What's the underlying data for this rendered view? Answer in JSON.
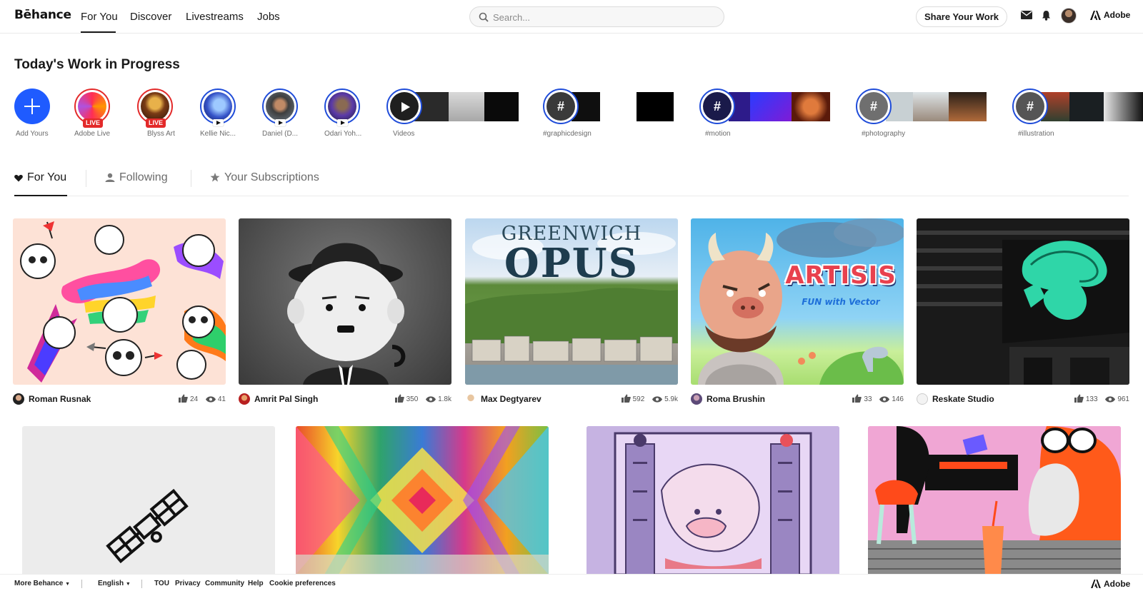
{
  "nav": {
    "logo": "Bēhance",
    "links": [
      "For You",
      "Discover",
      "Livestreams",
      "Jobs"
    ],
    "search_placeholder": "Search...",
    "share_label": "Share Your Work",
    "adobe_label": "Adobe"
  },
  "wip": {
    "title": "Today's Work in Progress",
    "items": [
      {
        "label": "Add Yours"
      },
      {
        "label": "Adobe Live",
        "badge": "LIVE"
      },
      {
        "label": "Blyss Art",
        "badge": "LIVE"
      },
      {
        "label": "Kellie Nic..."
      },
      {
        "label": "Daniel (D..."
      },
      {
        "label": "Odari Yoh..."
      },
      {
        "label": "Videos"
      },
      {
        "label": "#graphicdesign"
      },
      {
        "label": "#motion"
      },
      {
        "label": "#photography"
      },
      {
        "label": "#illustration"
      }
    ]
  },
  "tabs": [
    {
      "label": "For You",
      "icon": "heart-icon"
    },
    {
      "label": "Following",
      "icon": "person-icon"
    },
    {
      "label": "Your Subscriptions",
      "icon": "star-icon"
    }
  ],
  "projects": [
    {
      "owner": "Roman Rusnak",
      "likes": "24",
      "views": "41"
    },
    {
      "owner": "Amrit Pal Singh",
      "likes": "350",
      "views": "1.8k"
    },
    {
      "owner": "Max Degtyarev",
      "likes": "592",
      "views": "5.9k",
      "title_top": "GREENWICH",
      "title_main": "OPUS"
    },
    {
      "owner": "Roma Brushin",
      "likes": "33",
      "views": "146",
      "title_main": "ARTISIS",
      "subtitle": "FUN with Vector"
    },
    {
      "owner": "Reskate Studio",
      "likes": "133",
      "views": "961"
    }
  ],
  "footer": {
    "more": "More Behance",
    "language": "English",
    "links": [
      "TOU",
      "Privacy",
      "Community",
      "Help",
      "Cookie preferences"
    ],
    "adobe": "Adobe"
  }
}
